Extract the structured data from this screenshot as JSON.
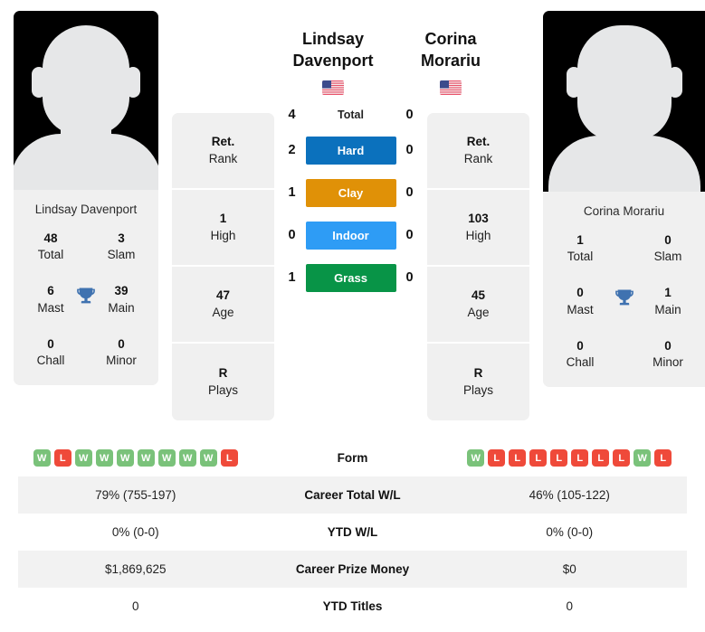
{
  "players": {
    "left": {
      "first_name": "Lindsay",
      "last_name": "Davenport",
      "full_name": "Lindsay Davenport",
      "country": "USA",
      "flag": "us-flag-icon",
      "titles": {
        "total_value": "48",
        "total_label": "Total",
        "slam_value": "3",
        "slam_label": "Slam",
        "mast_value": "6",
        "mast_label": "Mast",
        "main_value": "39",
        "main_label": "Main",
        "chall_value": "0",
        "chall_label": "Chall",
        "minor_value": "0",
        "minor_label": "Minor"
      },
      "info": [
        {
          "value": "Ret.",
          "label": "Rank"
        },
        {
          "value": "1",
          "label": "High"
        },
        {
          "value": "47",
          "label": "Age"
        },
        {
          "value": "R",
          "label": "Plays"
        }
      ],
      "form": [
        "W",
        "L",
        "W",
        "W",
        "W",
        "W",
        "W",
        "W",
        "W",
        "L"
      ],
      "career_total_wl": "79% (755-197)",
      "ytd_wl": "0% (0-0)",
      "career_prize_money": "$1,869,625",
      "ytd_titles": "0"
    },
    "right": {
      "first_name": "Corina",
      "last_name": "Morariu",
      "full_name": "Corina Morariu",
      "country": "USA",
      "flag": "us-flag-icon",
      "titles": {
        "total_value": "1",
        "total_label": "Total",
        "slam_value": "0",
        "slam_label": "Slam",
        "mast_value": "0",
        "mast_label": "Mast",
        "main_value": "1",
        "main_label": "Main",
        "chall_value": "0",
        "chall_label": "Chall",
        "minor_value": "0",
        "minor_label": "Minor"
      },
      "info": [
        {
          "value": "Ret.",
          "label": "Rank"
        },
        {
          "value": "103",
          "label": "High"
        },
        {
          "value": "45",
          "label": "Age"
        },
        {
          "value": "R",
          "label": "Plays"
        }
      ],
      "form": [
        "W",
        "L",
        "L",
        "L",
        "L",
        "L",
        "L",
        "L",
        "W",
        "L"
      ],
      "career_total_wl": "46% (105-122)",
      "ytd_wl": "0% (0-0)",
      "career_prize_money": "$0",
      "ytd_titles": "0"
    }
  },
  "head_to_head": [
    {
      "label": "Total",
      "left": "4",
      "right": "0",
      "badge": false,
      "color": ""
    },
    {
      "label": "Hard",
      "left": "2",
      "right": "0",
      "badge": true,
      "color": "#0b71bd"
    },
    {
      "label": "Clay",
      "left": "1",
      "right": "0",
      "badge": true,
      "color": "#e09107"
    },
    {
      "label": "Indoor",
      "left": "0",
      "right": "0",
      "badge": true,
      "color": "#2e9cf5"
    },
    {
      "label": "Grass",
      "left": "1",
      "right": "0",
      "badge": true,
      "color": "#089447"
    }
  ],
  "table_rows": [
    {
      "label": "Form",
      "left": "",
      "right": "",
      "type": "form"
    },
    {
      "label": "Career Total W/L",
      "left": "79% (755-197)",
      "right": "46% (105-122)",
      "type": "text"
    },
    {
      "label": "YTD W/L",
      "left": "0% (0-0)",
      "right": "0% (0-0)",
      "type": "text"
    },
    {
      "label": "Career Prize Money",
      "left": "$1,869,625",
      "right": "$0",
      "type": "text"
    },
    {
      "label": "YTD Titles",
      "left": "0",
      "right": "0",
      "type": "text"
    }
  ],
  "colors": {
    "win": "#7ac27a",
    "loss": "#ef4a3a",
    "trophy": "#3f72b0",
    "card_bg": "#f0f0f0",
    "row_alt": "#f2f2f2"
  }
}
